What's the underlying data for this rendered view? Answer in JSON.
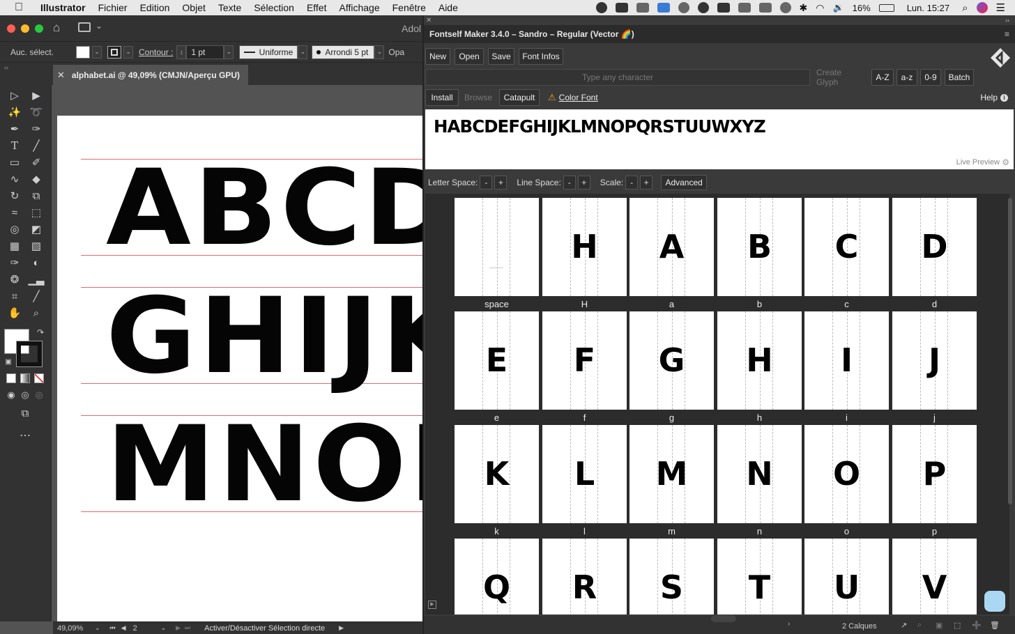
{
  "menubar": {
    "app": "Illustrator",
    "items": [
      "Fichier",
      "Edition",
      "Objet",
      "Texte",
      "Sélection",
      "Effet",
      "Affichage",
      "Fenêtre",
      "Aide"
    ],
    "battery": "16%",
    "clock": "Lun. 15:27"
  },
  "ai": {
    "title_partial": "Adol",
    "control": {
      "selection_label": "Auc. sélect.",
      "contour_label": "Contour :",
      "stroke_weight": "1 pt",
      "stroke_profile": "Uniforme",
      "brush": "Arrondi 5 pt",
      "opacity_partial": "Opa"
    },
    "doc_tab": "alphabet.ai @ 49,09% (CMJN/Aperçu GPU)",
    "artboard_rows": [
      "ABCDE",
      "GHIJK",
      "MNOPQ"
    ],
    "status": {
      "zoom": "49,09%",
      "artboard_num": "2",
      "message": "Activer/Désactiver Sélection directe"
    }
  },
  "fontself": {
    "title": "Fontself Maker 3.4.0 – Sandro – Regular (Vector 🌈)",
    "buttons_row1": [
      "New",
      "Open",
      "Save",
      "Font Infos"
    ],
    "type_placeholder": "Type any character",
    "create_glyph": "Create Glyph",
    "sets": [
      "A-Z",
      "a-z",
      "0-9",
      "Batch"
    ],
    "install": "Install",
    "browse": "Browse",
    "catapult": "Catapult",
    "color_font": "Color Font",
    "help": "Help",
    "preview_text": "HABCDEFGHIJKLMNOPQRSTUUWXYZ",
    "live_preview": "Live Preview",
    "letter_space": "Letter Space:",
    "line_space": "Line Space:",
    "scale": "Scale:",
    "minus": "-",
    "plus": "+",
    "advanced": "Advanced",
    "glyphs": [
      {
        "label": "space",
        "char": ""
      },
      {
        "label": "H",
        "char": "H"
      },
      {
        "label": "a",
        "char": "A"
      },
      {
        "label": "b",
        "char": "B"
      },
      {
        "label": "c",
        "char": "C"
      },
      {
        "label": "d",
        "char": "D"
      },
      {
        "label": "e",
        "char": "E"
      },
      {
        "label": "f",
        "char": "F"
      },
      {
        "label": "g",
        "char": "G"
      },
      {
        "label": "h",
        "char": "H"
      },
      {
        "label": "i",
        "char": "I"
      },
      {
        "label": "j",
        "char": "J"
      },
      {
        "label": "k",
        "char": "K"
      },
      {
        "label": "l",
        "char": "L"
      },
      {
        "label": "m",
        "char": "M"
      },
      {
        "label": "n",
        "char": "N"
      },
      {
        "label": "o",
        "char": "O"
      },
      {
        "label": "p",
        "char": "P"
      },
      {
        "label": "",
        "char": "Q"
      },
      {
        "label": "",
        "char": "R"
      },
      {
        "label": "",
        "char": "S"
      },
      {
        "label": "",
        "char": "T"
      },
      {
        "label": "",
        "char": "U"
      },
      {
        "label": "",
        "char": "V"
      }
    ],
    "layers": "2 Calques"
  },
  "colors": {
    "accent_warning": "#f0a020",
    "guide": "#e26b6b"
  }
}
